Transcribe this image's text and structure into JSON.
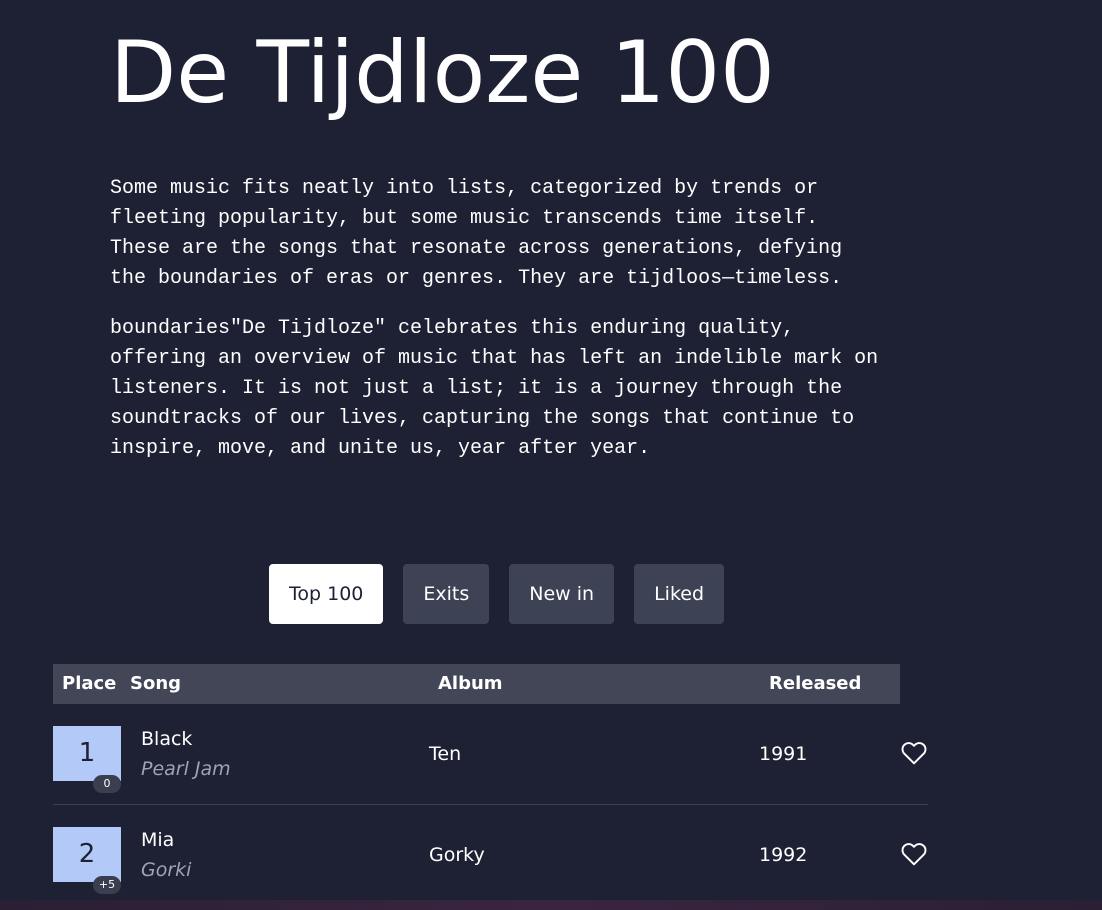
{
  "page": {
    "title": "De Tijdloze 100",
    "intro_paragraphs": [
      "Some music fits neatly into lists, categorized by trends or fleeting popularity, but some music transcends time itself. These are the songs that resonate across generations, defying the boundaries of eras or genres. They are tijdloos—timeless.",
      "boundaries\"De Tijdloze\" celebrates this enduring quality, offering an overview of music that has left an indelible mark on listeners. It is not just a list; it is a journey through the soundtracks of our lives, capturing the songs that continue to inspire, move, and unite us, year after year."
    ]
  },
  "tabs": [
    {
      "label": "Top 100",
      "active": true
    },
    {
      "label": "Exits",
      "active": false
    },
    {
      "label": "New in",
      "active": false
    },
    {
      "label": "Liked",
      "active": false
    }
  ],
  "table": {
    "headers": {
      "place": "Place",
      "song": "Song",
      "album": "Album",
      "released": "Released"
    },
    "rows": [
      {
        "place": "1",
        "change": "0",
        "song": "Black",
        "artist": "Pearl Jam",
        "album": "Ten",
        "released": "1991",
        "liked": false
      },
      {
        "place": "2",
        "change": "+5",
        "song": "Mia",
        "artist": "Gorki",
        "album": "Gorky",
        "released": "1992",
        "liked": false
      }
    ]
  },
  "icons": {
    "like": "heart-outline-icon"
  },
  "colors": {
    "background": "#1d2133",
    "tab_inactive": "#3d4254",
    "tab_active": "#ffffff",
    "header_bg": "#424656",
    "place_box": "#b3c9f8",
    "artist_text": "#9ea3b3"
  }
}
